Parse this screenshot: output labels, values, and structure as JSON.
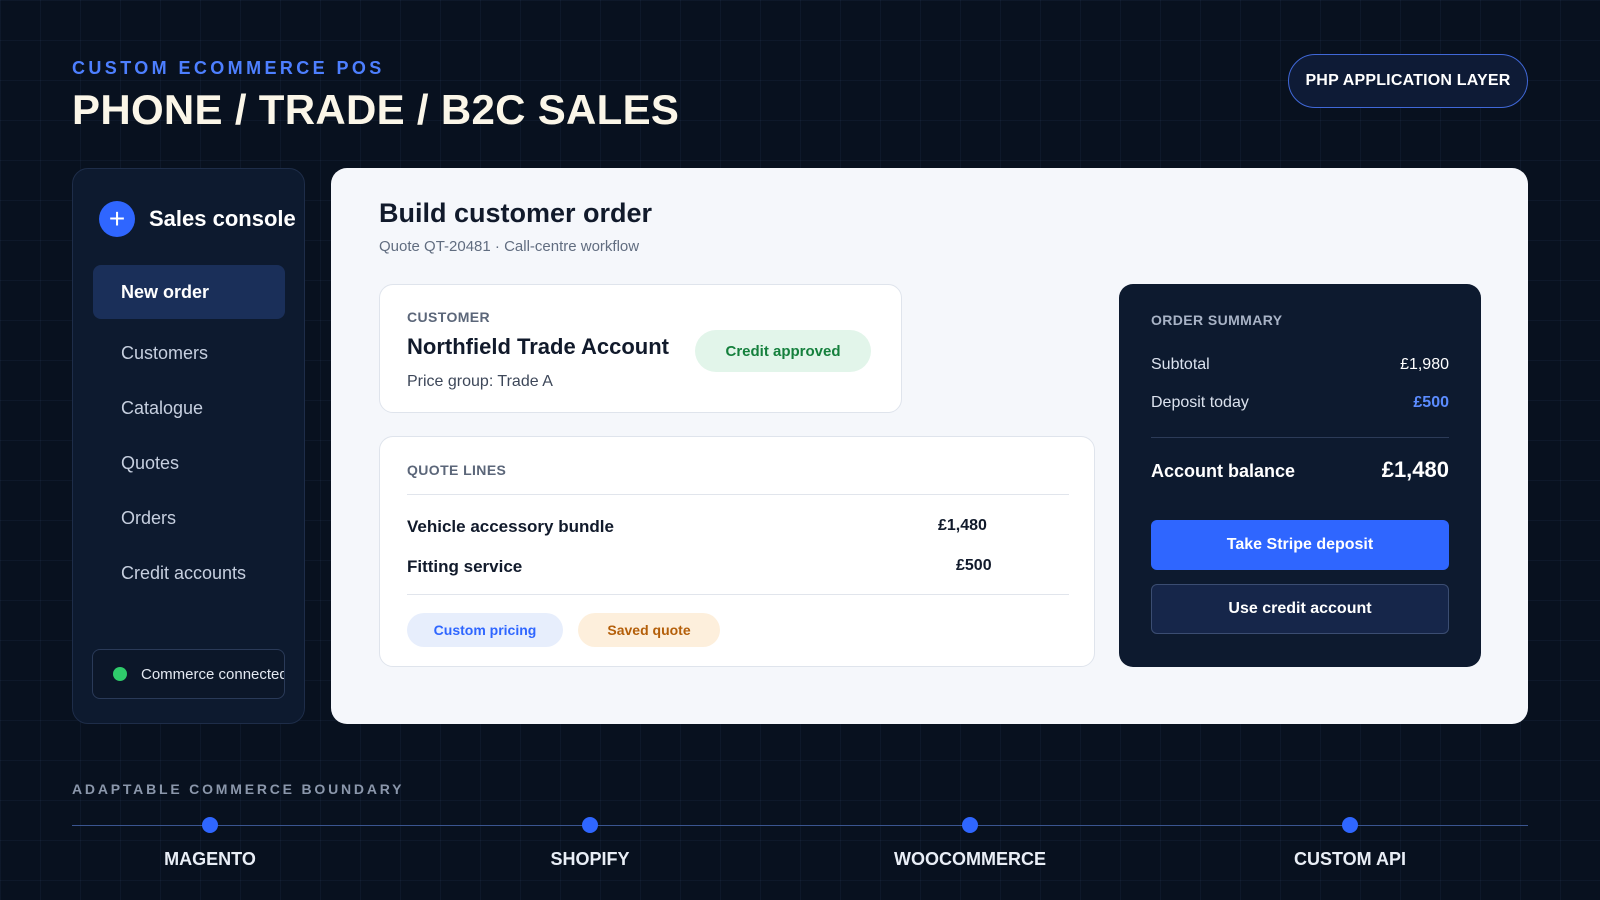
{
  "header": {
    "eyebrow": "CUSTOM ECOMMERCE POS",
    "title": "PHONE / TRADE / B2C SALES",
    "layer_badge": "PHP APPLICATION LAYER"
  },
  "sidebar": {
    "brand_icon": "plus-icon",
    "brand_title": "Sales console",
    "active_item": "New order",
    "items": [
      "Customers",
      "Catalogue",
      "Quotes",
      "Orders",
      "Credit accounts"
    ],
    "status": "Commerce connected",
    "status_color": "#2fcb6b"
  },
  "main": {
    "title": "Build customer order",
    "subtitle": "Quote QT-20481 · Call-centre workflow",
    "customer": {
      "label": "CUSTOMER",
      "name": "Northfield Trade Account",
      "price_group": "Price group: Trade A",
      "credit_status": "Credit approved"
    },
    "quote": {
      "label": "QUOTE LINES",
      "lines": [
        {
          "name": "Vehicle accessory bundle",
          "amount": "£1,480"
        },
        {
          "name": "Fitting service",
          "amount": "£500"
        }
      ],
      "tags": [
        "Custom pricing",
        "Saved quote"
      ]
    },
    "summary": {
      "label": "ORDER SUMMARY",
      "subtotal_label": "Subtotal",
      "subtotal": "£1,980",
      "deposit_label": "Deposit today",
      "deposit": "£500",
      "balance_label": "Account balance",
      "balance": "£1,480",
      "primary_action": "Take Stripe deposit",
      "secondary_action": "Use credit account"
    }
  },
  "boundary": {
    "label": "ADAPTABLE COMMERCE BOUNDARY",
    "platforms": [
      "MAGENTO",
      "SHOPIFY",
      "WOOCOMMERCE",
      "CUSTOM API"
    ]
  },
  "colors": {
    "accent": "#2f66ff",
    "background": "#08111f",
    "panel": "#f5f7fb",
    "success": "#15803d",
    "warning": "#b45f0a"
  }
}
